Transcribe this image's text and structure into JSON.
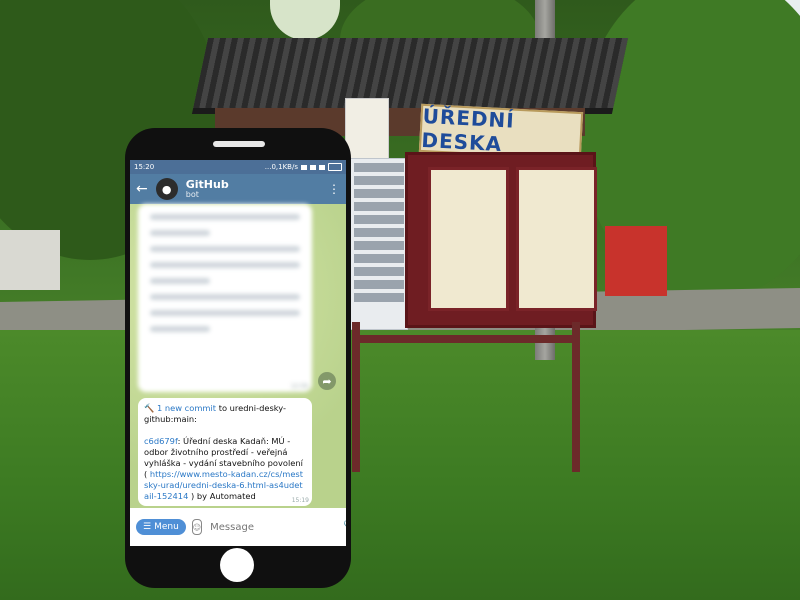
{
  "scene": {
    "sign_text": "ÚŘEDNÍ DESKA"
  },
  "status_bar": {
    "time": "15:20",
    "network": "...0,1KB/s",
    "icons": [
      "alarm-icon",
      "signal-icon",
      "wifi-icon",
      "battery-icon"
    ]
  },
  "header": {
    "back_icon": "←",
    "avatar_icon": "github-octocat-icon",
    "title": "GitHub",
    "subtitle": "bot",
    "menu_icon": "⋮"
  },
  "chat": {
    "blurred_message_time": "12:59",
    "forward_icon": "➦",
    "message": {
      "hammer": "🔨",
      "commit_link": "1 new commit",
      "text_to": " to uredni-desky-github:main:",
      "hash_link": "c6d679f",
      "body": ": Úřední deska Kadaň: MÚ - odbor životního prostředí - veřejná vyhláška - vydání stavebního povolení (",
      "url": "https://www.mesto-kadan.cz/cs/mestsky-urad/uredni-deska-6.html-as4udetail-152414",
      "tail": ") by Automated",
      "time": "15:19"
    }
  },
  "input_bar": {
    "menu_label": "Menu",
    "placeholder": "Message",
    "attach_icon": "📎",
    "mic_icon": "🎤"
  },
  "colors": {
    "telegram_header": "#527da3",
    "link": "#2a78c6",
    "menu_button": "#4f8fd6"
  }
}
